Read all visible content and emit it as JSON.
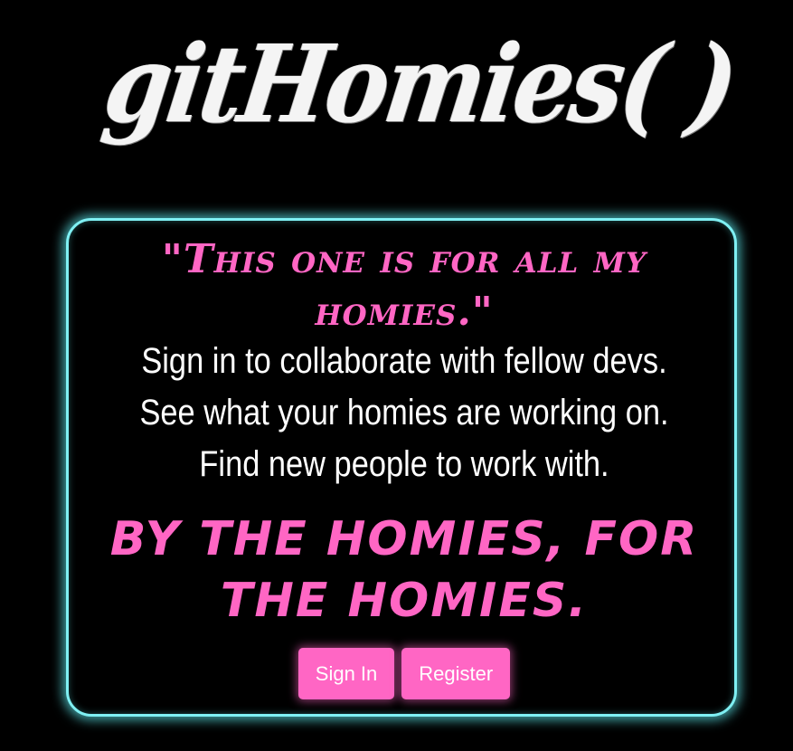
{
  "logo": {
    "text": "gitHomies( )"
  },
  "card": {
    "quote": "\"This one is for all my homies.\"",
    "lines": [
      "Sign in to collaborate with fellow devs.",
      "See what your homies are working on.",
      "Find new people to work with."
    ],
    "tagline": "BY THE HOMIES, FOR THE HOMIES."
  },
  "buttons": {
    "sign_in_label": "Sign In",
    "register_label": "Register"
  },
  "colors": {
    "background": "#000000",
    "accent_pink": "#ff66c4",
    "border_cyan": "#7ff0f3",
    "text_white": "#ffffff"
  }
}
